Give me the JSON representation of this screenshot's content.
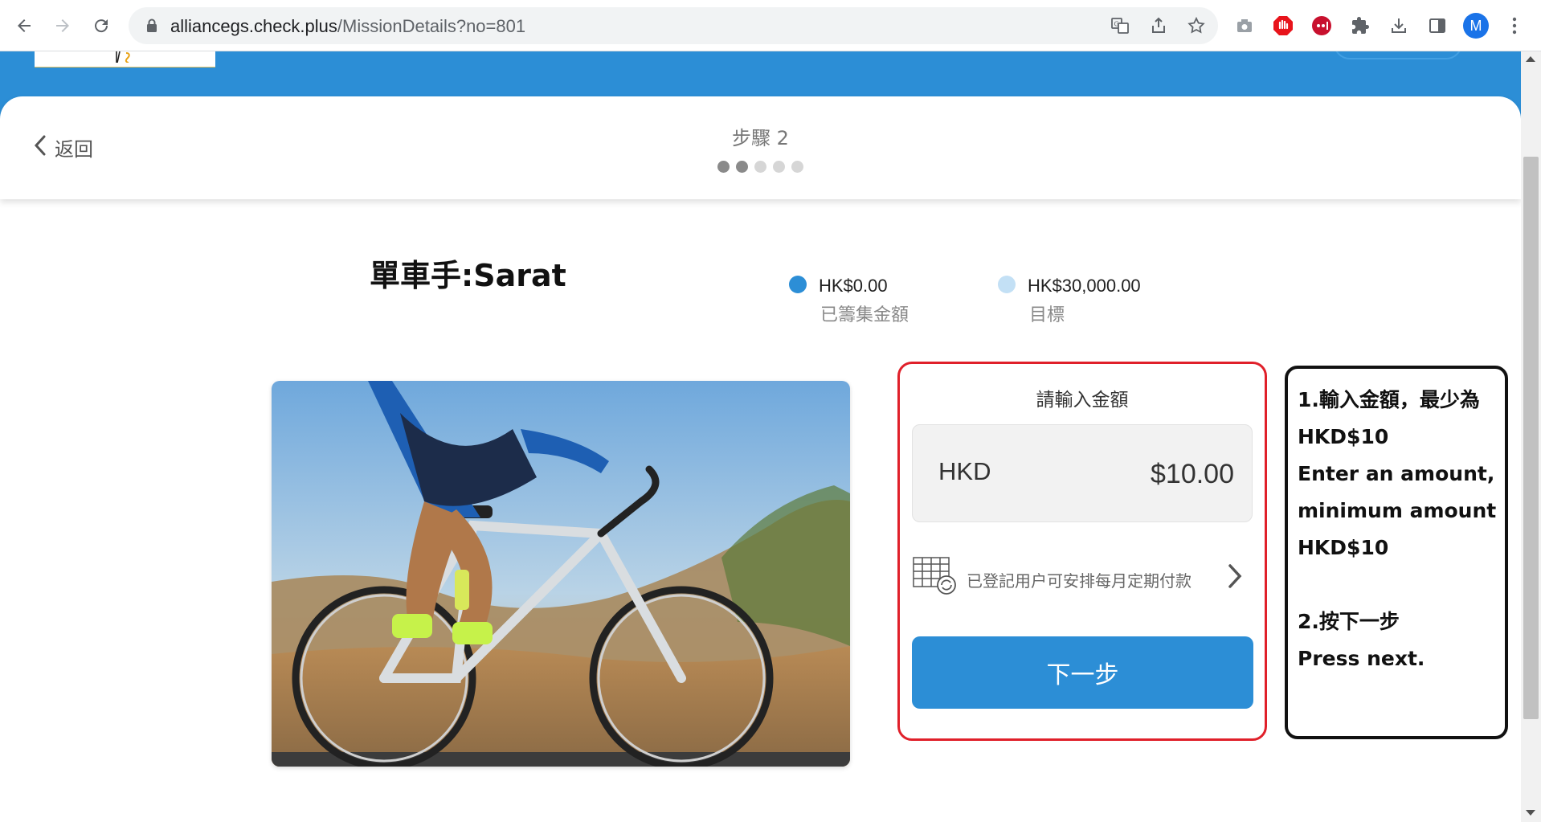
{
  "browser": {
    "url_host": "alliancegs.check.plus",
    "url_path": "/MissionDetails?no=801",
    "profile_initial": "M"
  },
  "nav": {
    "back_label": "返回",
    "step_label": "步驟 2",
    "total_steps": 5,
    "current_step": 2
  },
  "mission": {
    "title": "單車手:Sarat",
    "raised_value": "HK$0.00",
    "raised_label": "已籌集金額",
    "target_value": "HK$30,000.00",
    "target_label": "目標"
  },
  "donation": {
    "title": "請輸入金額",
    "currency": "HKD",
    "amount": "$10.00",
    "recurring_text": "已登記用户可安排每月定期付款",
    "next_label": "下一步"
  },
  "instructions": {
    "lines": [
      "1.輸入金額，最少為",
      "HKD$10",
      "Enter an amount,",
      "minimum amount",
      "HKD$10",
      "2.按下一步",
      "Press next."
    ]
  },
  "colors": {
    "brand_blue": "#2c8ed6",
    "raised_dot": "#2c8ed6",
    "target_dot": "#c3e0f5",
    "highlight_red": "#e0202a"
  }
}
